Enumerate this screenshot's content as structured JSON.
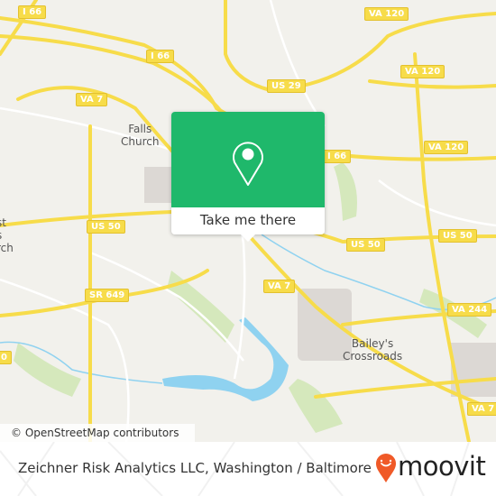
{
  "map": {
    "road_shields": [
      {
        "id": "i66-nw",
        "label": "I 66"
      },
      {
        "id": "i66-mid",
        "label": "I 66"
      },
      {
        "id": "va120-top",
        "label": "VA 120"
      },
      {
        "id": "us29",
        "label": "US 29"
      },
      {
        "id": "va120-right",
        "label": "VA 120"
      },
      {
        "id": "va7-nw",
        "label": "VA 7"
      },
      {
        "id": "i66-e",
        "label": "I 66"
      },
      {
        "id": "va120-e",
        "label": "VA 120"
      },
      {
        "id": "us50-w",
        "label": "US 50"
      },
      {
        "id": "us50-mid",
        "label": "US 50"
      },
      {
        "id": "us50-e",
        "label": "US 50"
      },
      {
        "id": "va7-mid",
        "label": "VA 7"
      },
      {
        "id": "sr649",
        "label": "SR 649"
      },
      {
        "id": "va244",
        "label": "VA 244"
      },
      {
        "id": "va7-se",
        "label": "VA 7"
      },
      {
        "id": "edge-left",
        "label": "0"
      }
    ],
    "places": [
      {
        "id": "falls-church",
        "label": "Falls\nChurch"
      },
      {
        "id": "west-falls-church",
        "label": "st\ns\nrch"
      },
      {
        "id": "baileys-crossroads",
        "label": "Bailey's\nCrossroads"
      }
    ],
    "colors": {
      "road": "#f7dc4a",
      "water": "#8fd2f0",
      "park": "#cde6b0",
      "popup": "#1fb86b",
      "brand": "#f05a28"
    }
  },
  "popup": {
    "icon": "map-pin-icon",
    "cta": "Take me there"
  },
  "attribution": "© OpenStreetMap contributors",
  "footer": {
    "title": "Zeichner Risk Analytics LLC, Washington / Baltimore",
    "brand": "moovit"
  }
}
